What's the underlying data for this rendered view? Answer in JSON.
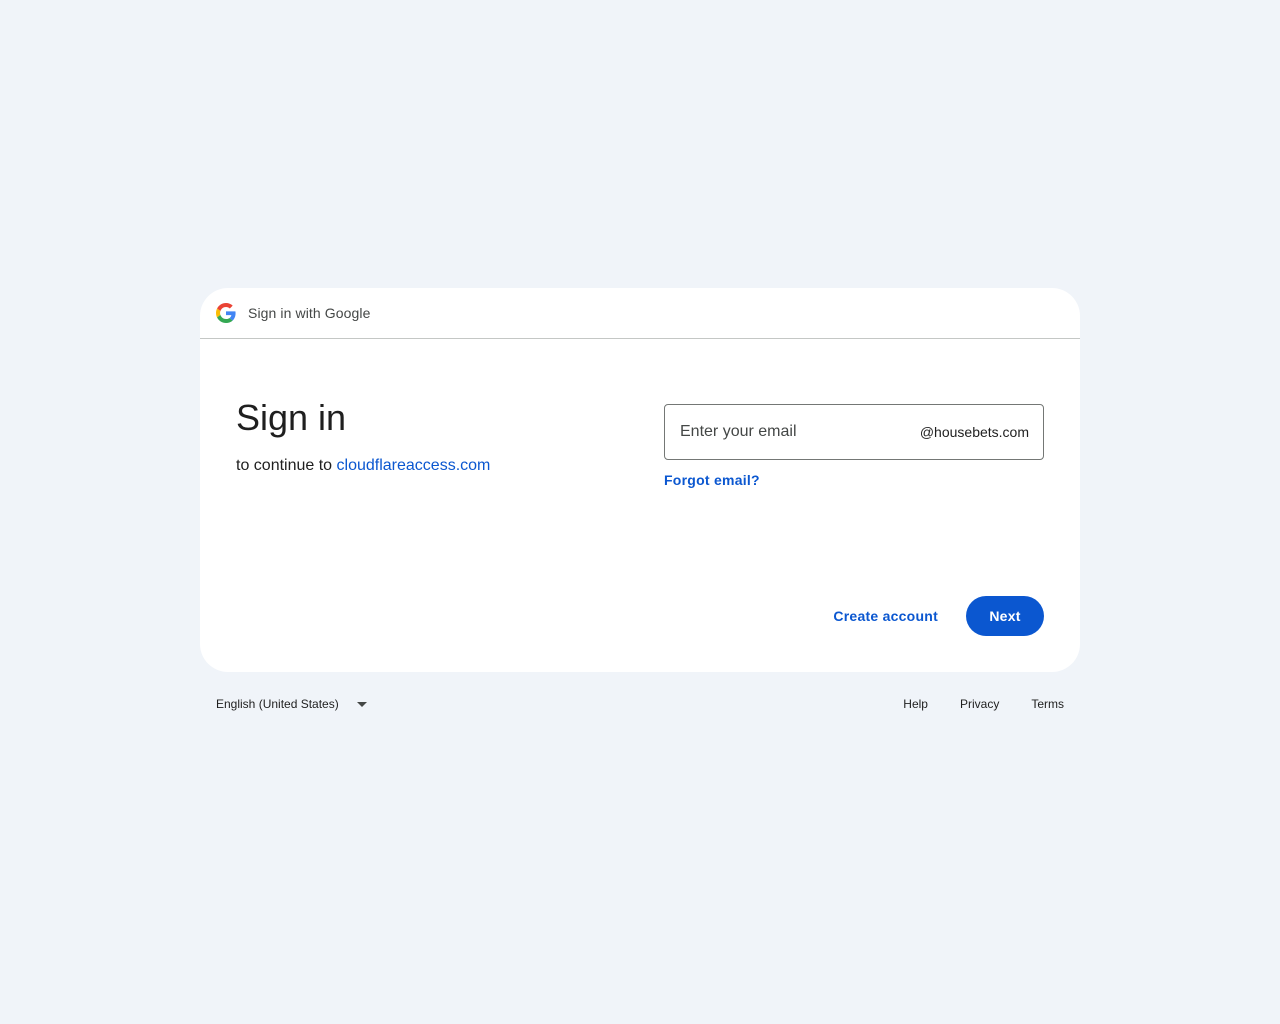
{
  "header": {
    "title": "Sign in with Google",
    "logo_icon": "google-g-icon"
  },
  "main": {
    "title": "Sign in",
    "subtitle_prefix": "to continue to ",
    "subtitle_link": "cloudflareaccess.com"
  },
  "email": {
    "placeholder": "Enter your email",
    "value": "",
    "domain_suffix": "@housebets.com"
  },
  "links": {
    "forgot_email": "Forgot email?"
  },
  "actions": {
    "create_account": "Create account",
    "next": "Next"
  },
  "footer": {
    "language": "English (United States)",
    "language_icon": "caret-down-icon",
    "help": "Help",
    "privacy": "Privacy",
    "terms": "Terms"
  },
  "colors": {
    "background": "#f0f4f9",
    "card": "#ffffff",
    "accent": "#0b57d0",
    "text": "#1f1f1f"
  }
}
